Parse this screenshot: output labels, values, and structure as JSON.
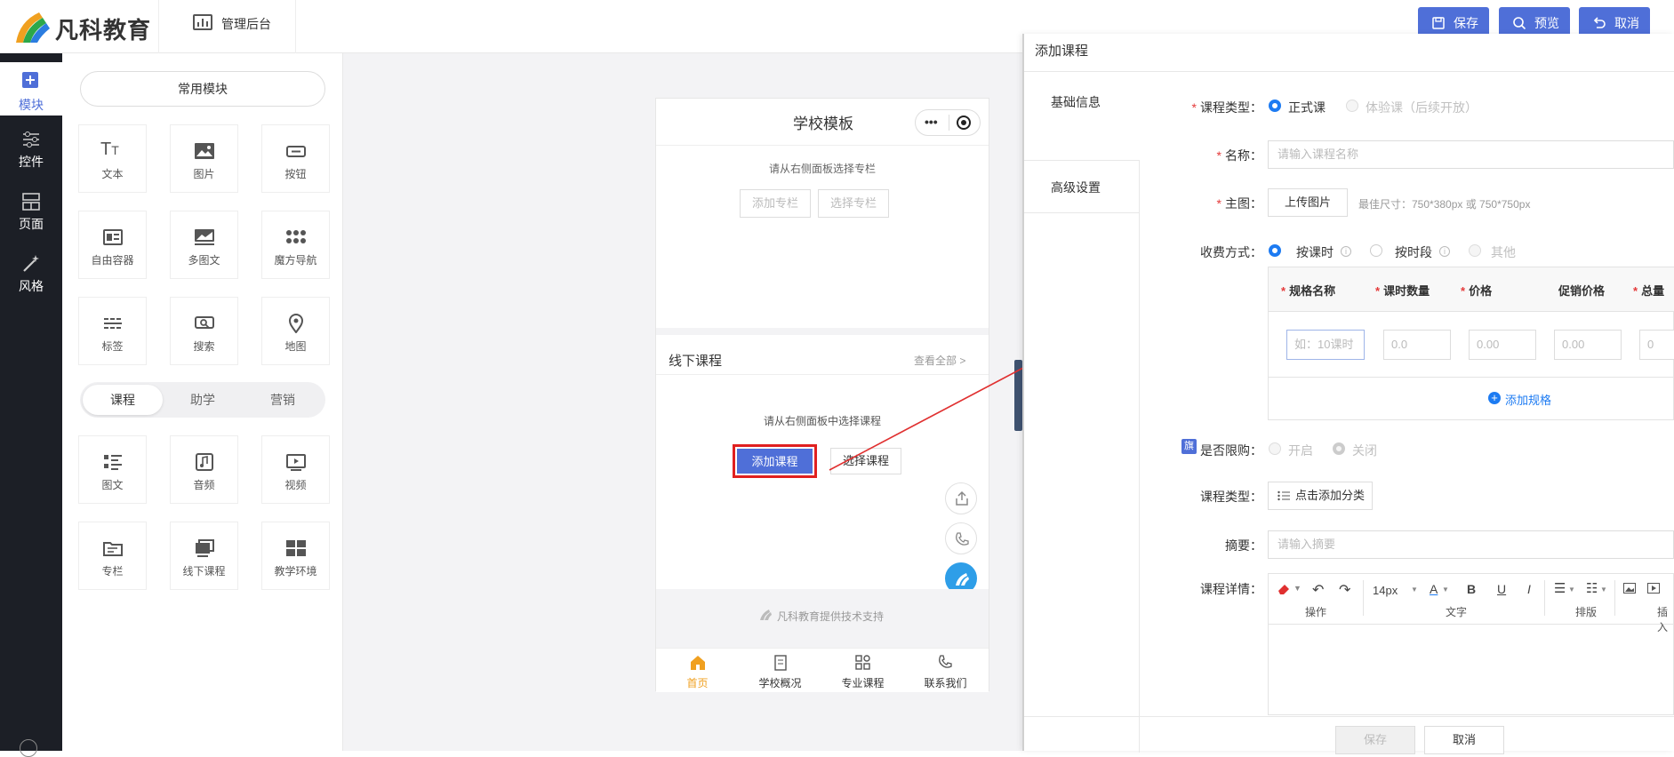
{
  "app": {
    "logo_text": "凡科教育",
    "admin_label": "管理后台",
    "save": "保存",
    "preview": "预览",
    "cancel": "取消"
  },
  "sidebar": {
    "items": [
      {
        "label": "模块",
        "icon": "plus-square-icon"
      },
      {
        "label": "控件",
        "icon": "sliders-icon"
      },
      {
        "label": "页面",
        "icon": "page-layout-icon"
      },
      {
        "label": "风格",
        "icon": "magic-wand-icon"
      }
    ]
  },
  "widgets": {
    "common_label": "常用模块",
    "common": [
      {
        "label": "文本",
        "icon": "text-icon"
      },
      {
        "label": "图片",
        "icon": "image-icon"
      },
      {
        "label": "按钮",
        "icon": "button-icon"
      },
      {
        "label": "自由容器",
        "icon": "container-icon"
      },
      {
        "label": "多图文",
        "icon": "multi-image-text-icon"
      },
      {
        "label": "魔方导航",
        "icon": "dots-grid-icon"
      },
      {
        "label": "标签",
        "icon": "tag-icon"
      },
      {
        "label": "搜索",
        "icon": "search-icon"
      },
      {
        "label": "地图",
        "icon": "map-pin-icon"
      }
    ],
    "tabs": [
      "课程",
      "助学",
      "营销"
    ],
    "course": [
      {
        "label": "图文",
        "icon": "list-icon"
      },
      {
        "label": "音频",
        "icon": "audio-icon"
      },
      {
        "label": "视频",
        "icon": "video-icon"
      },
      {
        "label": "专栏",
        "icon": "folder-icon"
      },
      {
        "label": "线下课程",
        "icon": "offline-course-icon"
      },
      {
        "label": "教学环境",
        "icon": "environment-icon"
      }
    ]
  },
  "phone": {
    "title": "学校模板",
    "column_hint": "请从右侧面板选择专栏",
    "add_column": "添加专栏",
    "select_column": "选择专栏",
    "offline_title": "线下课程",
    "view_all": "查看全部 >",
    "course_hint": "请从右侧面板中选择课程",
    "add_course": "添加课程",
    "select_course": "选择课程",
    "footer": "凡科教育提供技术支持",
    "tabs": [
      {
        "label": "首页",
        "icon": "home-icon"
      },
      {
        "label": "学校概况",
        "icon": "document-icon"
      },
      {
        "label": "专业课程",
        "icon": "grid-icon"
      },
      {
        "label": "联系我们",
        "icon": "phone-icon"
      }
    ]
  },
  "dialog": {
    "title": "添加课程",
    "nav": [
      "基础信息",
      "高级设置"
    ],
    "course_type_label": "课程类型：",
    "type_formal": "正式课",
    "type_trial": "体验课（后续开放）",
    "name_label": "名称：",
    "name_placeholder": "请输入课程名称",
    "cover_label": "主图：",
    "upload": "上传图片",
    "cover_hint": "最佳尺寸：750*380px 或 750*750px",
    "fee_label": "收费方式：",
    "fee_by_lesson": "按课时",
    "fee_by_period": "按时段",
    "fee_other": "其他",
    "spec_headers": [
      "规格名称",
      "课时数量",
      "价格",
      "促销价格",
      "总量"
    ],
    "spec_placeholders": [
      "如：10课时",
      "0.0",
      "0.00",
      "0.00",
      "0"
    ],
    "add_spec": "添加规格",
    "flag_badge": "旗",
    "limit_label": "是否限购：",
    "limit_on": "开启",
    "limit_off": "关闭",
    "category_label": "课程类型：",
    "add_category": "点击添加分类",
    "summary_label": "摘要：",
    "summary_placeholder": "请输入摘要",
    "detail_label": "课程详情：",
    "font_size": "14px",
    "toolbar_groups": [
      "操作",
      "文字",
      "排版",
      "插入"
    ],
    "save": "保存",
    "cancel": "取消"
  },
  "colors": {
    "primary": "#4f6fd8",
    "sidebar_bg": "#1c1f26",
    "highlight": "#e02020",
    "tab_active": "#f0a020",
    "radio_active": "#1d7bf2"
  }
}
